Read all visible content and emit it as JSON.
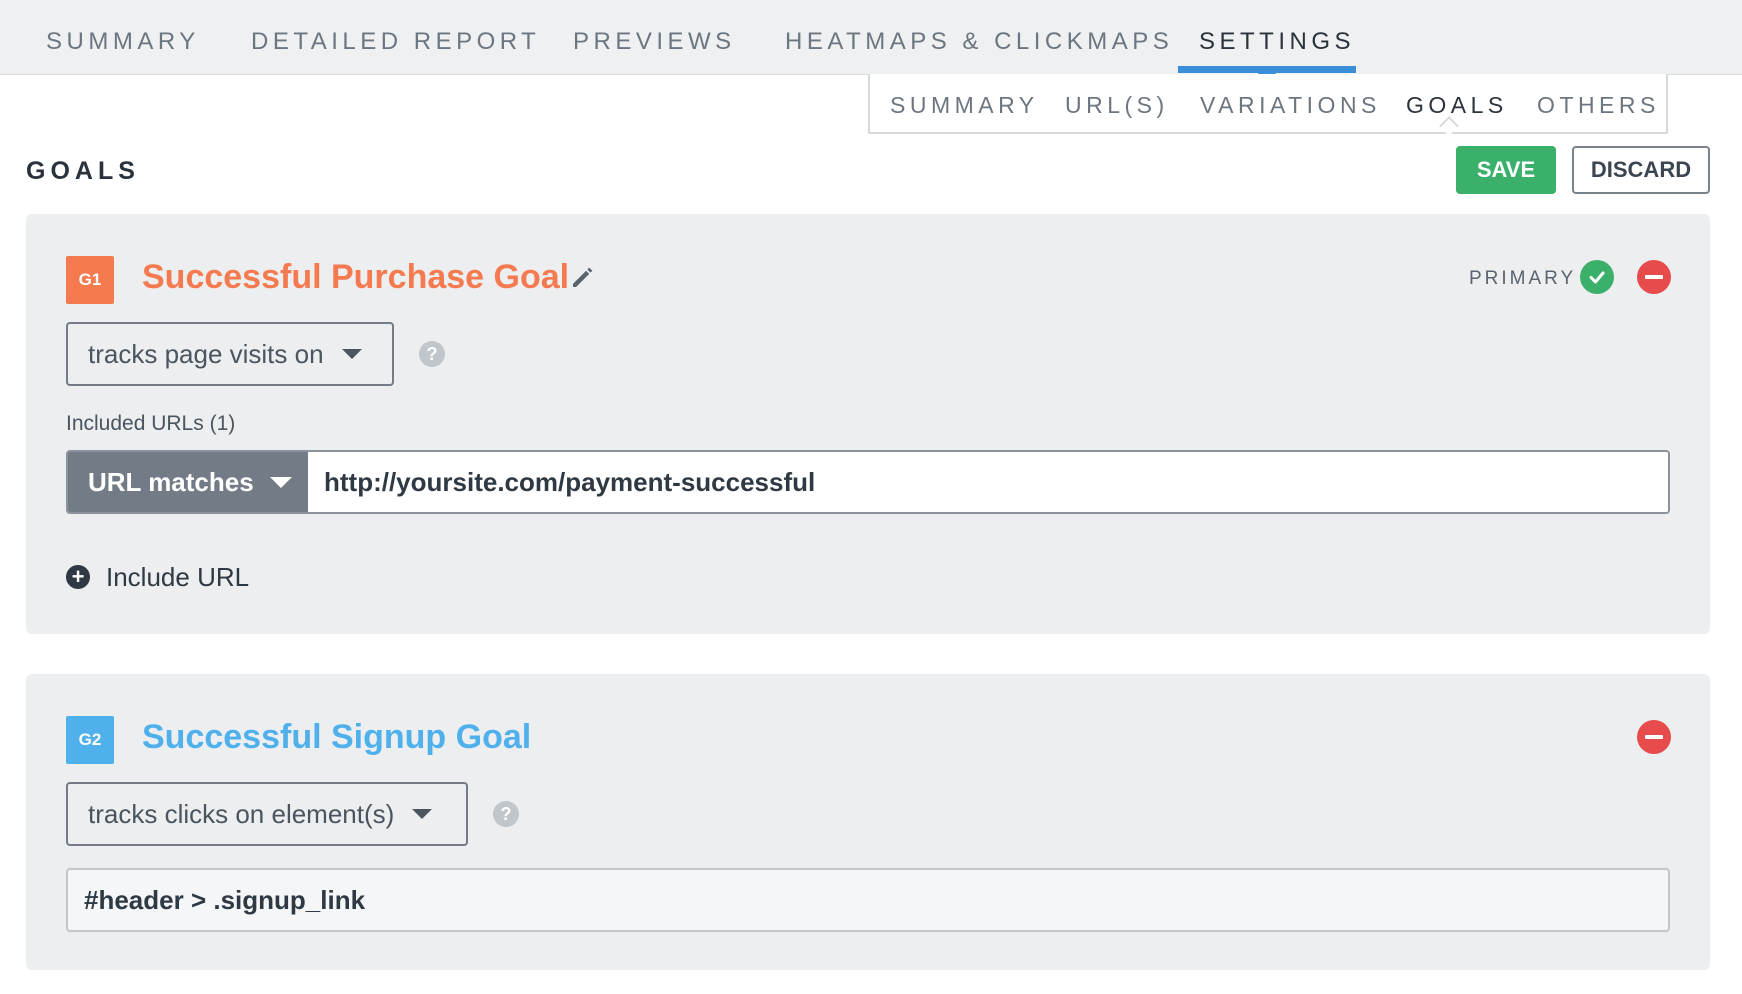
{
  "colors": {
    "accent_blue": "#3a8fd8",
    "goal1_orange": "#f57a4f",
    "goal2_blue": "#4fb0ec",
    "save_green": "#3bb06b",
    "remove_red": "#e84b4b"
  },
  "top_tabs": [
    {
      "label": "SUMMARY",
      "active": false
    },
    {
      "label": "DETAILED REPORT",
      "active": false
    },
    {
      "label": "PREVIEWS",
      "active": false
    },
    {
      "label": "HEATMAPS & CLICKMAPS",
      "active": false
    },
    {
      "label": "SETTINGS",
      "active": true
    }
  ],
  "sub_tabs": [
    {
      "label": "SUMMARY",
      "active": false
    },
    {
      "label": "URL(S)",
      "active": false
    },
    {
      "label": "VARIATIONS",
      "active": false
    },
    {
      "label": "GOALS",
      "active": true
    },
    {
      "label": "OTHERS",
      "active": false
    }
  ],
  "header": {
    "title": "GOALS",
    "save_label": "SAVE",
    "discard_label": "DISCARD"
  },
  "goals": [
    {
      "badge": "G1",
      "name": "Successful Purchase Goal",
      "primary_label": "PRIMARY",
      "is_primary": true,
      "tracking_type": "tracks page visits on",
      "included_urls_label": "Included URLs (1)",
      "url_match_type": "URL matches",
      "url_value": "http://yoursite.com/payment-successful",
      "include_url_label": "Include URL",
      "icons": {
        "edit": "pencil-icon",
        "primary": "check-circle-icon",
        "remove": "minus-circle-icon",
        "help": "question-icon",
        "add": "plus-circle-icon"
      }
    },
    {
      "badge": "G2",
      "name": "Successful Signup Goal",
      "is_primary": false,
      "tracking_type": "tracks clicks on element(s)",
      "selector_value": "#header > .signup_link",
      "icons": {
        "remove": "minus-circle-icon",
        "help": "question-icon"
      }
    }
  ]
}
